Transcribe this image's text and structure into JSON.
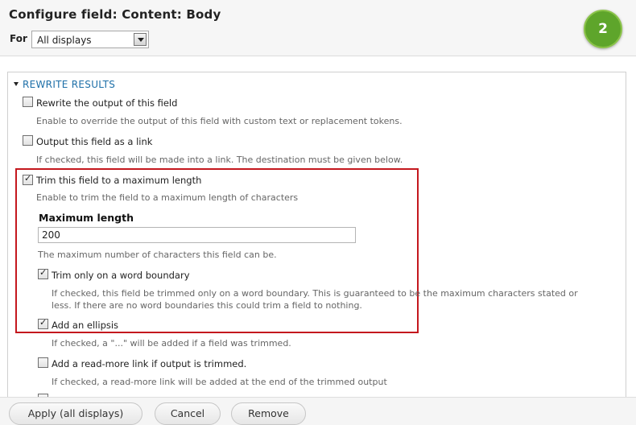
{
  "header": {
    "title": "Configure field: Content: Body",
    "for_label": "For",
    "for_select_value": "All displays",
    "step_badge": "2"
  },
  "fieldset": {
    "legend": "REWRITE RESULTS",
    "options": [
      {
        "label": "Rewrite the output of this field",
        "checked": false,
        "description": "Enable to override the output of this field with custom text or replacement tokens."
      },
      {
        "label": "Output this field as a link",
        "checked": false,
        "description": "If checked, this field will be made into a link. The destination must be given below."
      },
      {
        "label": "Trim this field to a maximum length",
        "checked": true,
        "description": "Enable to trim the field to a maximum length of characters"
      }
    ],
    "max_length": {
      "label": "Maximum length",
      "value": "200",
      "description": "The maximum number of characters this field can be."
    },
    "sub_options": [
      {
        "label": "Trim only on a word boundary",
        "checked": true,
        "description_line1": "If checked, this field be trimmed only on a word boundary. This is guaranteed to be the maximum characters stated or",
        "description_line2": "less. If there are no word boundaries this could trim a field to nothing."
      },
      {
        "label": "Add an ellipsis",
        "checked": true,
        "description": "If checked, a \"...\" will be added if a field was trimmed."
      },
      {
        "label": "Add a read-more link if output is trimmed.",
        "checked": false,
        "description": "If checked, a read-more link will be added at the end of the trimmed output"
      }
    ]
  },
  "buttons": {
    "apply": "Apply (all displays)",
    "cancel": "Cancel",
    "remove": "Remove"
  },
  "colors": {
    "badge": "#5ea52b",
    "legend": "#1d6fa8",
    "highlight_border": "#c4181e"
  }
}
